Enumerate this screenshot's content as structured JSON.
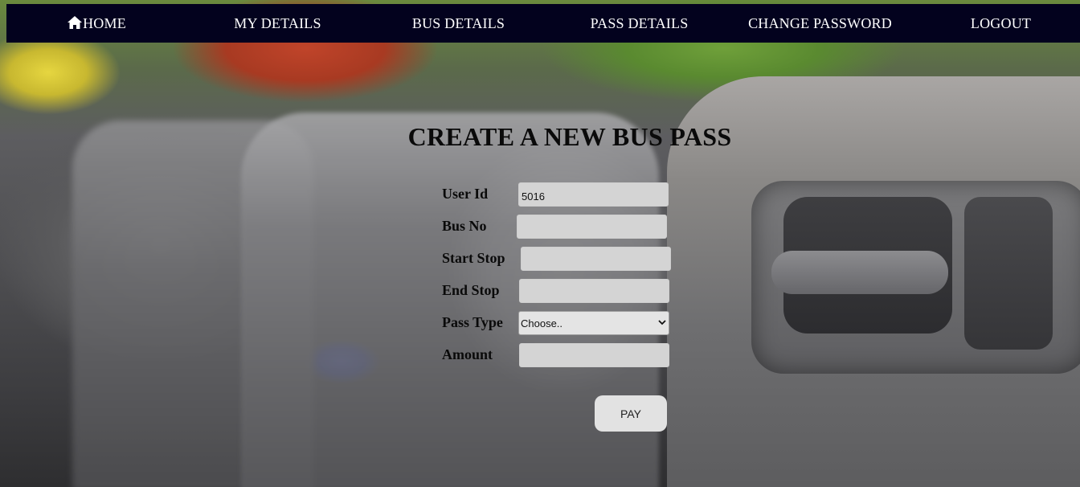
{
  "nav": {
    "items": [
      {
        "label": "HOME",
        "icon": "home-icon"
      },
      {
        "label": "MY DETAILS"
      },
      {
        "label": "BUS DETAILS"
      },
      {
        "label": "PASS DETAILS"
      },
      {
        "label": "CHANGE PASSWORD"
      },
      {
        "label": "LOGOUT"
      }
    ],
    "background_color": "#03021e",
    "text_color": "#ffffff"
  },
  "form": {
    "title": "CREATE A NEW BUS PASS",
    "fields": {
      "user_id": {
        "label": "User Id",
        "value": "5016"
      },
      "bus_no": {
        "label": "Bus No",
        "value": ""
      },
      "start_stop": {
        "label": "Start Stop",
        "value": ""
      },
      "end_stop": {
        "label": "End Stop",
        "value": ""
      },
      "pass_type": {
        "label": "Pass Type",
        "selected": "Choose.."
      },
      "amount": {
        "label": "Amount",
        "value": ""
      }
    },
    "submit_label": "PAY"
  },
  "background": {
    "description_icon": "bus-seats-background"
  }
}
